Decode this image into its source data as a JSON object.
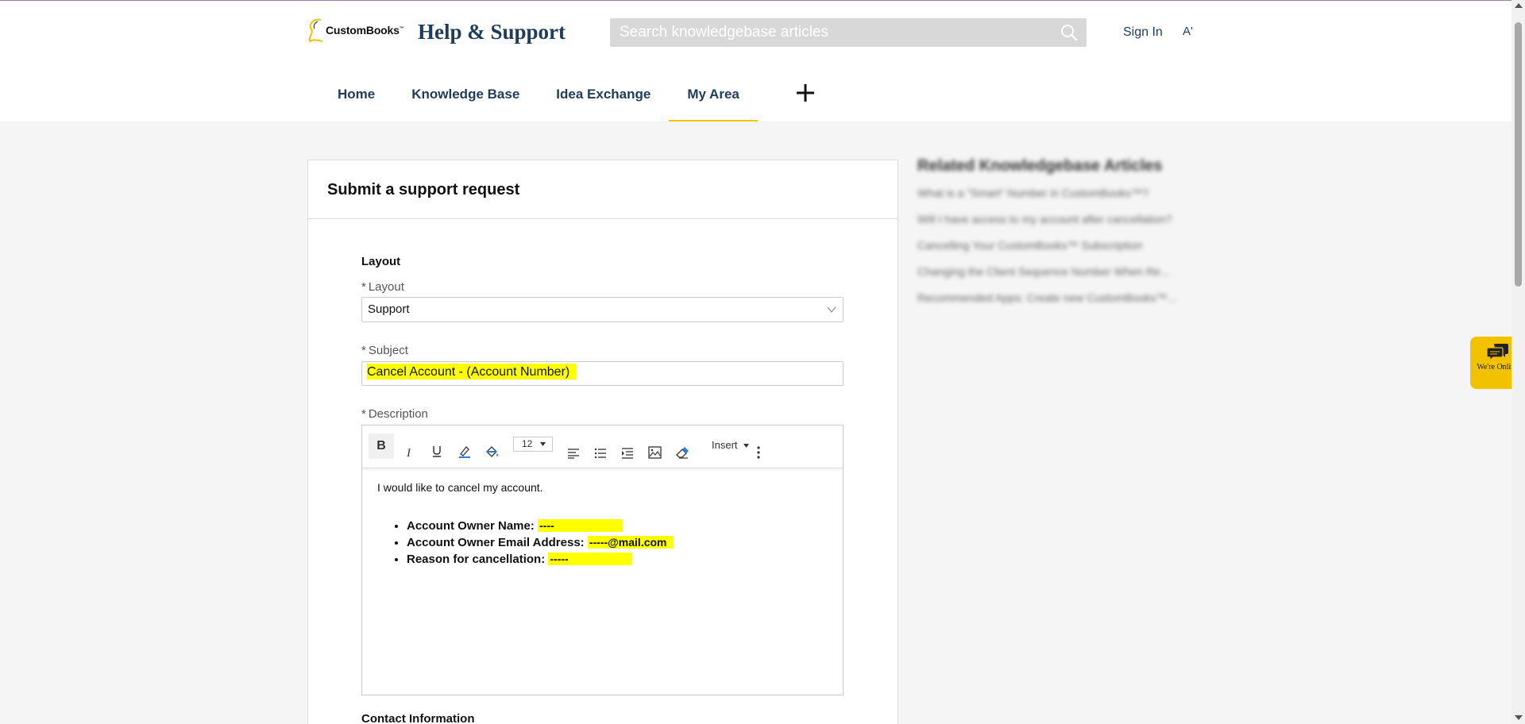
{
  "header": {
    "logo_text": "CustomBooks",
    "logo_tm": "™",
    "site_title": "Help & Support",
    "search_placeholder": "Search knowledgebase articles",
    "sign_in": "Sign In",
    "font_toggle": "A'"
  },
  "nav": {
    "items": [
      {
        "label": "Home",
        "active": false
      },
      {
        "label": "Knowledge Base",
        "active": false
      },
      {
        "label": "Idea Exchange",
        "active": false
      },
      {
        "label": "My Area",
        "active": true
      }
    ]
  },
  "form": {
    "title": "Submit a support request",
    "section_title": "Layout",
    "required_mark": "*",
    "layout_label": "Layout",
    "layout_value": "Support",
    "subject_label": "Subject",
    "subject_value": "Cancel Account - (Account Number)",
    "description_label": "Description",
    "toolbar": {
      "font_size": "12",
      "insert_label": "Insert"
    },
    "description": {
      "intro": "I would like to cancel my account.",
      "items": [
        {
          "label": "Account Owner Name:",
          "value": "----"
        },
        {
          "label": "Account Owner Email Address:",
          "value": "-----@mail.com"
        },
        {
          "label": "Reason for cancellation:",
          "value": "-----"
        }
      ]
    },
    "contact_title": "Contact Information"
  },
  "related": {
    "title": "Related Knowledgebase Articles",
    "articles": [
      "What is a \"Smart\" Number in CustomBooks™?",
      "Will I have access to my account after cancellation?",
      "Cancelling Your CustomBooks™ Subscription",
      "Changing the Client Sequence Number When Re...",
      "Recommended Apps: Create new CustomBooks™..."
    ]
  },
  "chat": {
    "label": "We're Online"
  },
  "colors": {
    "accent": "#f2c200",
    "brand": "#1f3c5a",
    "highlight": "#ffff00"
  }
}
